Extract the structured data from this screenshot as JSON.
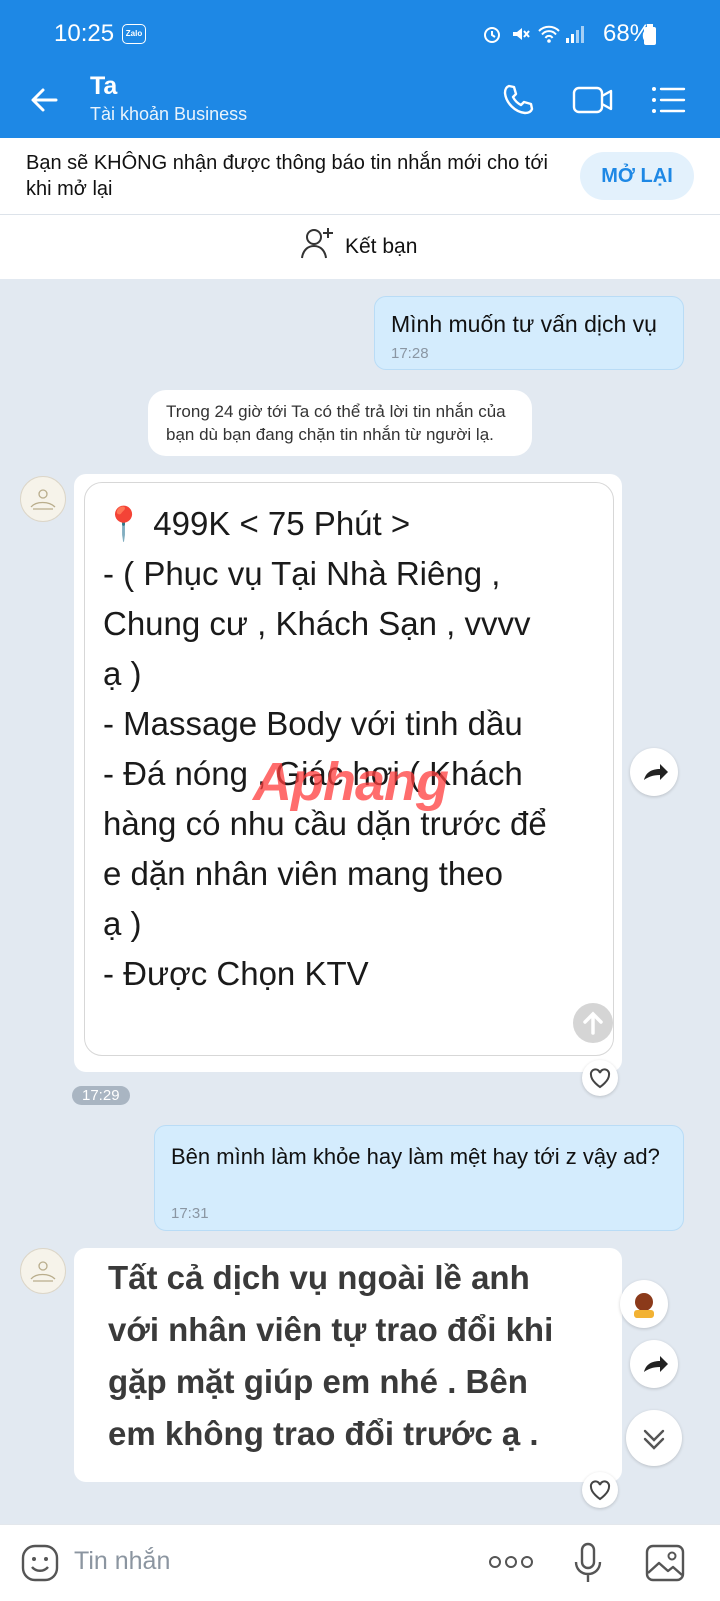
{
  "status_bar": {
    "time": "10:25",
    "app_badge": "Zalo",
    "battery": "68%"
  },
  "header": {
    "title": "Ta",
    "subtitle": "Tài khoản Business"
  },
  "banner": {
    "text": "Bạn sẽ KHÔNG nhận được thông báo tin nhắn mới cho tới khi mở lại",
    "button": "MỞ LẠI"
  },
  "add_friend": {
    "label": "Kết bạn"
  },
  "messages": [
    {
      "type": "outgoing",
      "text": "Mình muốn tư vấn dịch vụ",
      "time": "17:28"
    },
    {
      "type": "notice",
      "text": "Trong 24 giờ tới Ta có thể trả lời tin nhắn của bạn dù bạn đang chặn tin nhắn từ người lạ."
    },
    {
      "type": "incoming-image",
      "lines": [
        "📍 499K < 75 Phút >",
        "- ( Phục vụ Tại Nhà Riêng ,",
        "Chung cư , Khách Sạn , vvvv",
        "ạ )",
        "- Massage Body với tinh dầu",
        "- Đá nóng , Giác hơi ( Khách",
        "hàng có nhu cầu dặn trước để",
        "e dặn nhân viên mang theo",
        "ạ )",
        "- Được Chọn KTV"
      ],
      "watermark": "Aphang",
      "time": "17:29"
    },
    {
      "type": "outgoing",
      "text": "Bên mình làm khỏe hay làm mệt hay tới z vậy ad?",
      "time": "17:31"
    },
    {
      "type": "incoming-image",
      "lines": [
        "Tất cả dịch vụ ngoài lề anh",
        "với nhân viên tự trao đổi khi",
        "gặp mặt giúp em nhé . Bên",
        "em không trao đổi trước ạ ."
      ]
    }
  ],
  "composer": {
    "placeholder": "Tin nhắn"
  },
  "colors": {
    "header": "#1e88e5",
    "outgoing_bubble": "#d4ecfd",
    "background": "#e2e9f1"
  }
}
